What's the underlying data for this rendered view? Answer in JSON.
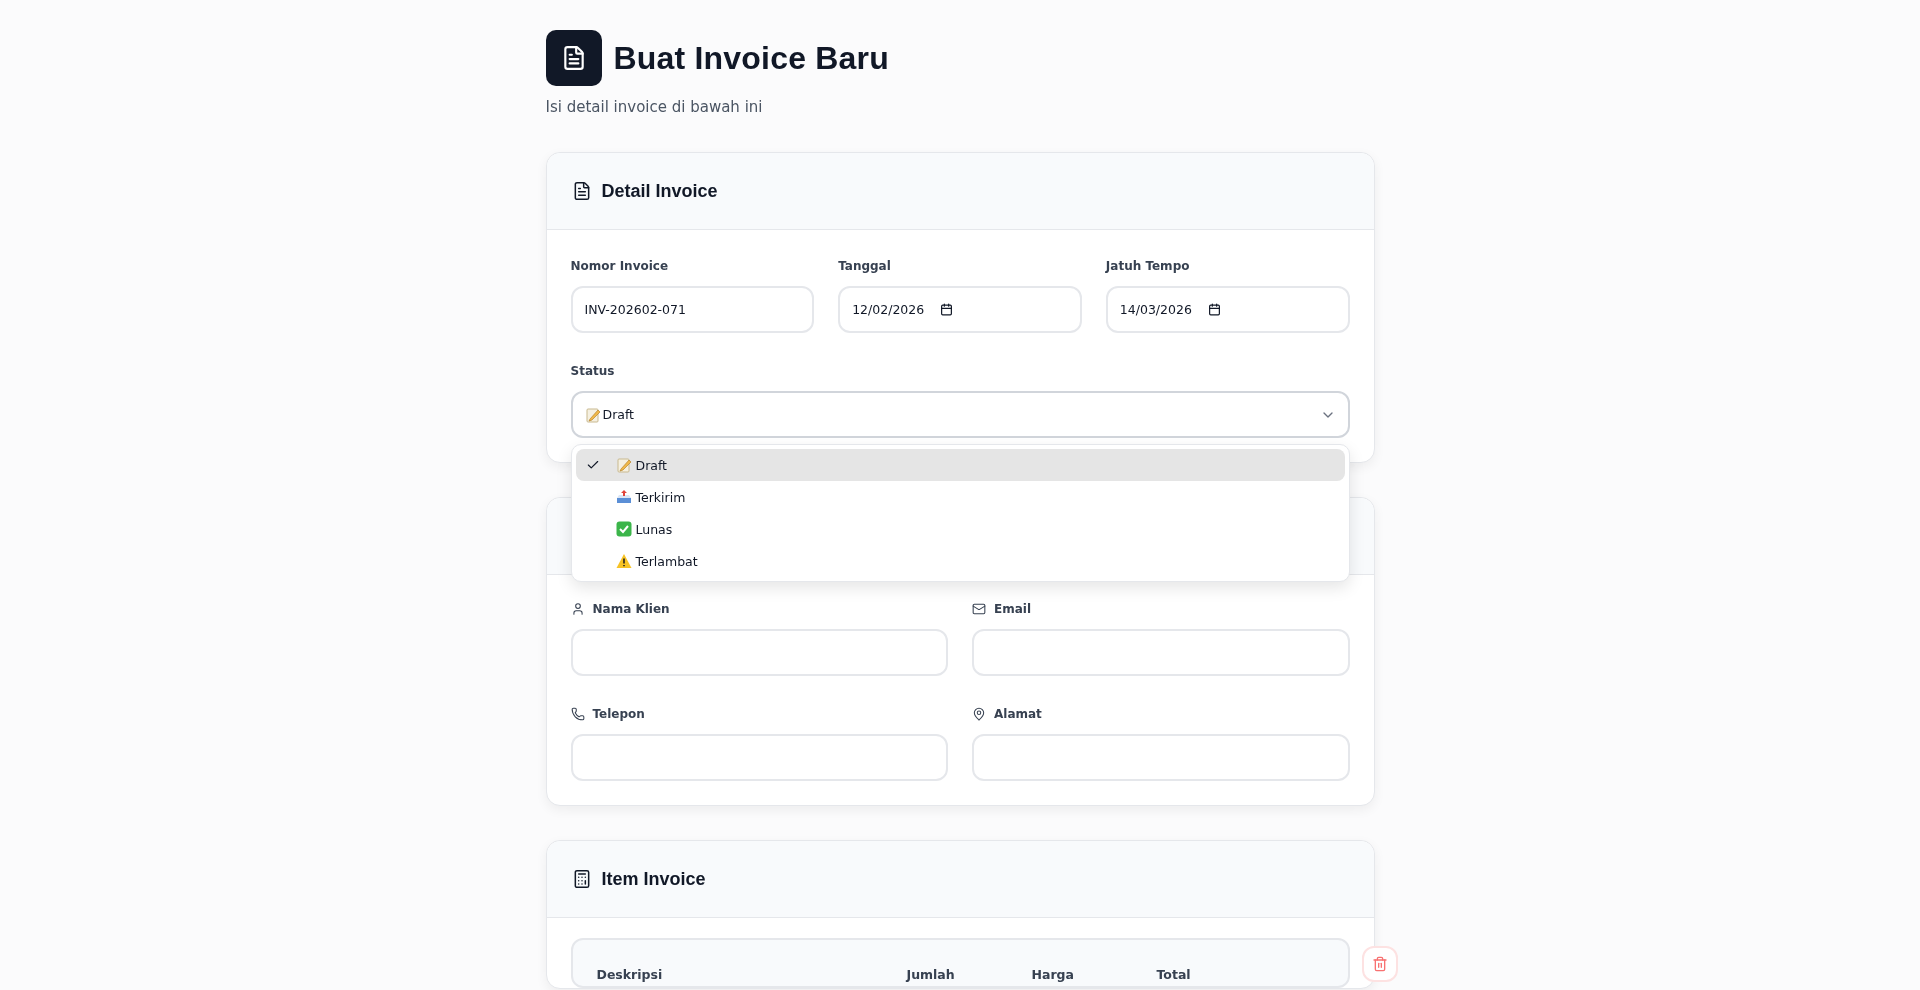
{
  "header": {
    "title": "Buat Invoice Baru",
    "subtitle": "Isi detail invoice di bawah ini"
  },
  "detail_card": {
    "title": "Detail Invoice",
    "fields": [
      {
        "label": "Nomor Invoice",
        "value": "INV-202602-071",
        "kind": "text"
      },
      {
        "label": "Tanggal",
        "value": "12/02/2026",
        "kind": "date"
      },
      {
        "label": "Jatuh Tempo",
        "value": "14/03/2026",
        "kind": "date"
      }
    ],
    "status": {
      "label": "Status",
      "value": "Draft",
      "expanded": true,
      "options": [
        {
          "label": "Draft",
          "kind": "memo",
          "selected": true
        },
        {
          "label": "Terkirim",
          "kind": "outbox",
          "selected": false
        },
        {
          "label": "Lunas",
          "kind": "check",
          "selected": false
        },
        {
          "label": "Terlambat",
          "kind": "warning",
          "selected": false
        }
      ]
    }
  },
  "client_card": {
    "fields": [
      {
        "label": "Nama Klien",
        "kind": "person"
      },
      {
        "label": "Email",
        "kind": "mail"
      },
      {
        "label": "Telepon",
        "kind": "phone"
      },
      {
        "label": "Alamat",
        "kind": "pin"
      }
    ]
  },
  "items_card": {
    "title": "Item Invoice",
    "columns": [
      "Deskripsi",
      "Jumlah",
      "Harga",
      "Total"
    ]
  }
}
